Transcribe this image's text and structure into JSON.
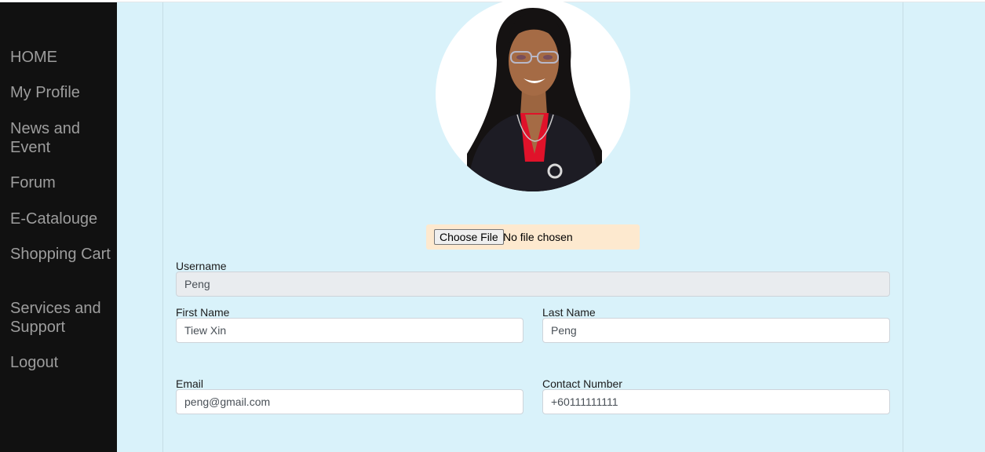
{
  "nav": {
    "items": [
      {
        "label": "HOME"
      },
      {
        "label": "My Profile"
      },
      {
        "label": "News and Event"
      },
      {
        "label": "Forum"
      },
      {
        "label": "E-Catalouge"
      },
      {
        "label": "Shopping Cart"
      },
      {
        "label": "Services and Support"
      },
      {
        "label": "Logout"
      }
    ]
  },
  "profile": {
    "photo_icon": "person-photo",
    "file_input": {
      "button_label": "Choose File",
      "status": "No file chosen"
    },
    "fields": {
      "username": {
        "label": "Username",
        "value": "Peng"
      },
      "first_name": {
        "label": "First Name",
        "value": "Tiew Xin"
      },
      "last_name": {
        "label": "Last Name",
        "value": "Peng"
      },
      "email": {
        "label": "Email",
        "value": "peng@gmail.com"
      },
      "contact": {
        "label": "Contact Number",
        "value": "+60111111111"
      }
    }
  },
  "colors": {
    "sidebar_bg": "#111111",
    "nav_text": "#9d9d9d",
    "page_bg": "#d9f2fa",
    "file_box_bg": "#fde9cf",
    "readonly_bg": "#e9ecef"
  }
}
